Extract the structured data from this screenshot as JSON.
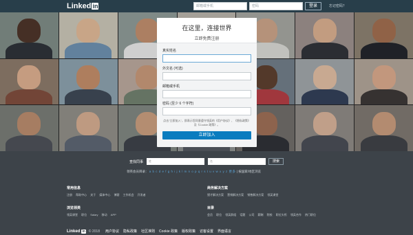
{
  "header": {
    "logo_text": "Linked",
    "logo_badge": "in",
    "email_placeholder": "邮箱或手机",
    "password_placeholder": "密码",
    "login_label": "登录",
    "forgot_label": "忘记密码？"
  },
  "signup": {
    "title": "在这里，连接世界",
    "subtitle": "立即免费注册",
    "fields": [
      {
        "label": "真实姓名"
      },
      {
        "label": "外文名 (可选)"
      },
      {
        "label": "邮箱或手机"
      },
      {
        "label": "密码 (至少 6 个字符)"
      }
    ],
    "terms": "点击\"立即加入\"，即表示您同意遵守领英的《用户协议》、《隐私政策》及《Cookie 政策》。",
    "join_label": "立即加入"
  },
  "member_search": {
    "label": "查找同事",
    "first_placeholder": "姓",
    "last_placeholder": "名",
    "button_label": "搜索",
    "directory_label": "领英会员目录：",
    "letters": "a b c d e f g h i j k l m n o p q r s t u v w x y z 更多",
    "country_label": "按国家/地区浏览"
  },
  "footer": {
    "sections": [
      {
        "title": "常用信息",
        "links": "注册 帮助中心 关于 媒体中心 博客 工作机会 开发者"
      },
      {
        "title": "商务解决方案",
        "links": "猎才解决方案 营销解决方案 销售解决方案 领英课堂"
      },
      {
        "title": "浏览领英",
        "links": "领英课堂 职位 Salary 移动 APP"
      },
      {
        "title": "目录",
        "links": "会员 职位 领英群组 话题 公司 薪酬 院校 职位头衔 领英合作 热门职位"
      }
    ],
    "bottom": {
      "logo_text": "Linked",
      "logo_badge": "in",
      "copyright": "© 2018",
      "links": [
        "用户协议",
        "隐私政策",
        "社区准则",
        "Cookie 政策",
        "版权政策",
        "访客设置",
        "界面语言"
      ]
    }
  },
  "colors": {
    "header_bg": "#283e4a",
    "page_bg": "#3d4349",
    "accent": "#0a7cbf"
  }
}
